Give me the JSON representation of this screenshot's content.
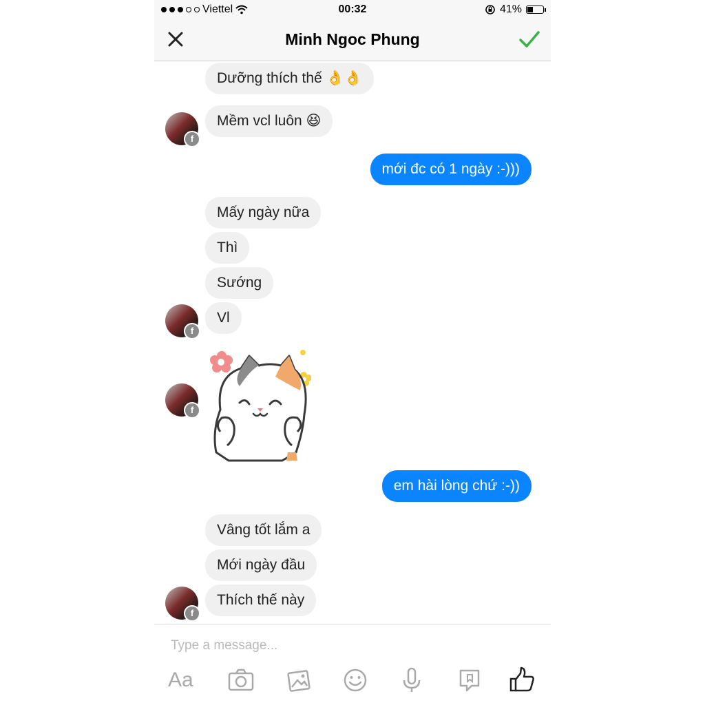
{
  "status_bar": {
    "carrier": "Viettel",
    "signal_bars_filled": 3,
    "signal_bars_total": 5,
    "time": "00:32",
    "battery_percent_label": "41%",
    "battery_level": 0.41
  },
  "header": {
    "title": "Minh Ngoc Phung",
    "close_icon": "close-icon",
    "done_icon": "checkmark-icon",
    "accent_color": "#3cb043"
  },
  "messages": [
    {
      "direction": "in",
      "text": "Dưỡng thích thế 👌👌"
    },
    {
      "direction": "in",
      "text": "Mềm vcl luôn 😆"
    },
    {
      "direction": "out",
      "text": "mới đc có 1 ngày :-)))"
    },
    {
      "direction": "in",
      "text": "Mấy ngày nữa"
    },
    {
      "direction": "in",
      "text": "Thì"
    },
    {
      "direction": "in",
      "text": "Sướng"
    },
    {
      "direction": "in",
      "text": "Vl"
    },
    {
      "direction": "in",
      "type": "sticker",
      "sticker": "cat-sticker"
    },
    {
      "direction": "out",
      "text": "em hài lòng chứ :-))"
    },
    {
      "direction": "in",
      "text": "Vâng tốt lắm a"
    },
    {
      "direction": "in",
      "text": "Mới ngày đầu"
    },
    {
      "direction": "in",
      "text": "Thích thế này"
    }
  ],
  "composer": {
    "placeholder": "Type a message...",
    "value": ""
  },
  "toolbar": {
    "text_label": "Aa",
    "icons": [
      "text-format-icon",
      "camera-icon",
      "gallery-icon",
      "emoji-icon",
      "microphone-icon",
      "pin-icon",
      "like-icon"
    ]
  },
  "colors": {
    "outgoing_bubble": "#0a84ff",
    "incoming_bubble": "#f0f0f0"
  }
}
